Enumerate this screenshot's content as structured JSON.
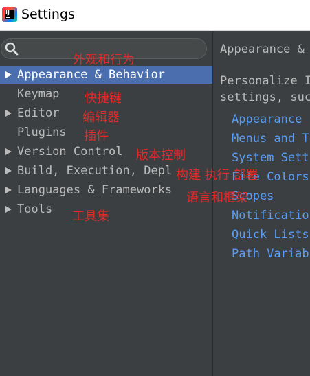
{
  "window": {
    "title": "Settings",
    "app_icon": "intellij-idea-icon"
  },
  "search": {
    "placeholder": "",
    "icon": "search-icon"
  },
  "tree": {
    "items": [
      {
        "label": "Appearance & Behavior",
        "expandable": true,
        "selected": true,
        "note": "外观和行为"
      },
      {
        "label": "Keymap",
        "expandable": false,
        "selected": false,
        "note": "快捷键"
      },
      {
        "label": "Editor",
        "expandable": true,
        "selected": false,
        "note": "编辑器"
      },
      {
        "label": "Plugins",
        "expandable": false,
        "selected": false,
        "note": "插件"
      },
      {
        "label": "Version Control",
        "expandable": true,
        "selected": false,
        "note": "版本控制"
      },
      {
        "label": "Build, Execution, Depl",
        "expandable": true,
        "selected": false,
        "note": "构建 执行 部署"
      },
      {
        "label": "Languages & Frameworks",
        "expandable": true,
        "selected": false,
        "note": "语言和框架"
      },
      {
        "label": "Tools",
        "expandable": true,
        "selected": false,
        "note": "工具集"
      }
    ]
  },
  "content": {
    "title": "Appearance &",
    "description_lines": [
      "Personalize I",
      "settings, suc"
    ],
    "links": [
      "Appearance",
      "Menus and To",
      "System Setti",
      "File Colors",
      "Scopes",
      "Notification",
      "Quick Lists",
      "Path Variabl"
    ]
  },
  "colors": {
    "background": "#3c3f41",
    "selection": "#4b6eaf",
    "link": "#589df6",
    "annotation": "#e02a2a"
  }
}
